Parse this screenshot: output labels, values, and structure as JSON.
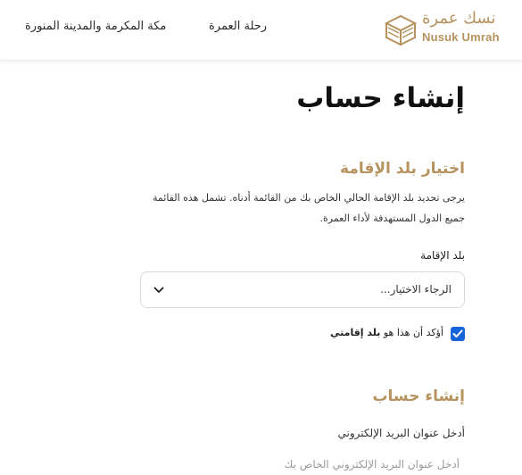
{
  "header": {
    "logo_ar": "نسك عمرة",
    "logo_en": "Nusuk Umrah",
    "nav": {
      "umrah_trip": "رحلة العمرة",
      "makkah_madinah": "مكة المكرمة والمدينة المنورة"
    }
  },
  "page": {
    "title": "إنشاء حساب"
  },
  "residence": {
    "section_title": "اختيار بلد الإقامة",
    "description": "يرجى تحديد بلد الإقامة الحالي الخاص بك من القائمة أدناه. تشمل هذه القائمة جميع الدول المستهدفة لأداء العمرة.",
    "field_label": "بلد الإقامة",
    "select_value": "الرجاء الاختيار...",
    "confirm_prefix": "أؤكد أن هذا هو",
    "confirm_bold": "بلد إقامتي",
    "confirm_checked": true
  },
  "account": {
    "section_title": "إنشاء حساب",
    "email_label": "أدخل عنوان البريد الإلكتروني",
    "email_placeholder": "أدخل عنوان البريد الإلكتروني الخاص بك",
    "email_value": ""
  },
  "colors": {
    "brand_gold": "#b6935e",
    "checkbox_blue": "#1565d8"
  }
}
